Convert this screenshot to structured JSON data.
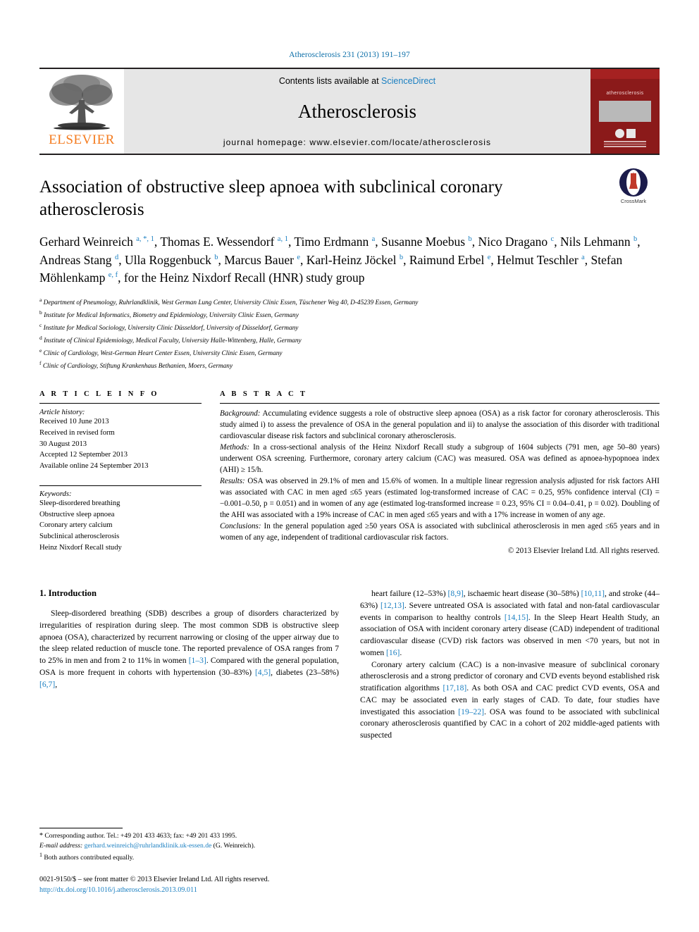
{
  "running_head": "Atherosclerosis 231 (2013) 191–197",
  "masthead": {
    "contents_prefix": "Contents lists available at ",
    "sciencedirect": "ScienceDirect",
    "journal_title": "Atherosclerosis",
    "homepage": "journal homepage: www.elsevier.com/locate/atherosclerosis",
    "publisher": "ELSEVIER",
    "cover_title": "atherosclerosis"
  },
  "article": {
    "title": "Association of obstructive sleep apnoea with subclinical coronary atherosclerosis",
    "crossmark_label": "CrossMark",
    "authors_html": "Gerhard Weinreich <sup>a, *, 1</sup>, Thomas E. Wessendorf <sup>a, 1</sup>, Timo Erdmann <sup>a</sup>, Susanne Moebus <sup>b</sup>, Nico Dragano <sup>c</sup>, Nils Lehmann <sup>b</sup>, Andreas Stang <sup>d</sup>, Ulla Roggenbuck <sup>b</sup>, Marcus Bauer <sup>e</sup>, Karl-Heinz Jöckel <sup>b</sup>, Raimund Erbel <sup>e</sup>, Helmut Teschler <sup>a</sup>, Stefan Möhlenkamp <sup>e, f</sup>, for the Heinz Nixdorf Recall (HNR) study group",
    "affiliations": [
      {
        "marker": "a",
        "text": "Department of Pneumology, Ruhrlandklinik, West German Lung Center, University Clinic Essen, Tüschener Weg 40, D-45239 Essen, Germany"
      },
      {
        "marker": "b",
        "text": "Institute for Medical Informatics, Biometry and Epidemiology, University Clinic Essen, Germany"
      },
      {
        "marker": "c",
        "text": "Institute for Medical Sociology, University Clinic Düsseldorf, University of Düsseldorf, Germany"
      },
      {
        "marker": "d",
        "text": "Institute of Clinical Epidemiology, Medical Faculty, University Halle-Wittenberg, Halle, Germany"
      },
      {
        "marker": "e",
        "text": "Clinic of Cardiology, West-German Heart Center Essen, University Clinic Essen, Germany"
      },
      {
        "marker": "f",
        "text": "Clinic of Cardiology, Stiftung Krankenhaus Bethanien, Moers, Germany"
      }
    ]
  },
  "article_info": {
    "heading": "A R T I C L E  I N F O",
    "history_label": "Article history:",
    "history": [
      "Received 10 June 2013",
      "Received in revised form",
      "30 August 2013",
      "Accepted 12 September 2013",
      "Available online 24 September 2013"
    ],
    "keywords_label": "Keywords:",
    "keywords": [
      "Sleep-disordered breathing",
      "Obstructive sleep apnoea",
      "Coronary artery calcium",
      "Subclinical atherosclerosis",
      "Heinz Nixdorf Recall study"
    ]
  },
  "abstract": {
    "heading": "A B S T R A C T",
    "sections": [
      {
        "label": "Background:",
        "text": " Accumulating evidence suggests a role of obstructive sleep apnoea (OSA) as a risk factor for coronary atherosclerosis. This study aimed i) to assess the prevalence of OSA in the general population and ii) to analyse the association of this disorder with traditional cardiovascular disease risk factors and subclinical coronary atherosclerosis."
      },
      {
        "label": "Methods:",
        "text": " In a cross-sectional analysis of the Heinz Nixdorf Recall study a subgroup of 1604 subjects (791 men, age 50–80 years) underwent OSA screening. Furthermore, coronary artery calcium (CAC) was measured. OSA was defined as apnoea-hypopnoea index (AHI) ≥ 15/h."
      },
      {
        "label": "Results:",
        "text": " OSA was observed in 29.1% of men and 15.6% of women. In a multiple linear regression analysis adjusted for risk factors AHI was associated with CAC in men aged ≤65 years (estimated log-transformed increase of CAC = 0.25, 95% confidence interval (CI) = −0.001–0.50, p = 0.051) and in women of any age (estimated log-transformed increase = 0.23, 95% CI = 0.04–0.41, p = 0.02). Doubling of the AHI was associated with a 19% increase of CAC in men aged ≤65 years and with a 17% increase in women of any age."
      },
      {
        "label": "Conclusions:",
        "text": " In the general population aged ≥50 years OSA is associated with subclinical atherosclerosis in men aged ≤65 years and in women of any age, independent of traditional cardiovascular risk factors."
      }
    ],
    "copyright": "© 2013 Elsevier Ireland Ltd. All rights reserved."
  },
  "body": {
    "section_heading": "1. Introduction",
    "left_paragraph_html": "Sleep-disordered breathing (SDB) describes a group of disorders characterized by irregularities of respiration during sleep. The most common SDB is obstructive sleep apnoea (OSA), characterized by recurrent narrowing or closing of the upper airway due to the sleep related reduction of muscle tone. The reported prevalence of OSA ranges from 7 to 25% in men and from 2 to 11% in women <span class=\"ref\">[1–3]</span>. Compared with the general population, OSA is more frequent in cohorts with hypertension (30–83%) <span class=\"ref\">[4,5]</span>, diabetes (23–58%) <span class=\"ref\">[6,7]</span>,",
    "right_paragraph1_html": "heart failure (12–53%) <span class=\"ref\">[8,9]</span>, ischaemic heart disease (30–58%) <span class=\"ref\">[10,11]</span>, and stroke (44–63%) <span class=\"ref\">[12,13]</span>. Severe untreated OSA is associated with fatal and non-fatal cardiovascular events in comparison to healthy controls <span class=\"ref\">[14,15]</span>. In the Sleep Heart Health Study, an association of OSA with incident coronary artery disease (CAD) independent of traditional cardiovascular disease (CVD) risk factors was observed in men &lt;70 years, but not in women <span class=\"ref\">[16]</span>.",
    "right_paragraph2_html": "Coronary artery calcium (CAC) is a non-invasive measure of subclinical coronary atherosclerosis and a strong predictor of coronary and CVD events beyond established risk stratification algorithms <span class=\"ref\">[17,18]</span>. As both OSA and CAC predict CVD events, OSA and CAC may be associated even in early stages of CAD. To date, four studies have investigated this association <span class=\"ref\">[19–22]</span>. OSA was found to be associated with subclinical coronary atherosclerosis quantified by CAC in a cohort of 202 middle-aged patients with suspected"
  },
  "footnotes": {
    "corresponding_html": "<span style=\"font-size:10px\">*</span> Corresponding author. Tel.: +49 201 433 4633; fax: +49 201 433 1995.",
    "email_html": "<span class=\"it\">E-mail address:</span> <span class=\"link\">gerhard.weinreich@ruhrlandklinik.uk-essen.de</span> (G. Weinreich).",
    "equal_html": "<sup>1</sup> Both authors contributed equally.",
    "imprint": "0021-9150/$ – see front matter © 2013 Elsevier Ireland Ltd. All rights reserved.",
    "doi": "http://dx.doi.org/10.1016/j.atherosclerosis.2013.09.011"
  }
}
